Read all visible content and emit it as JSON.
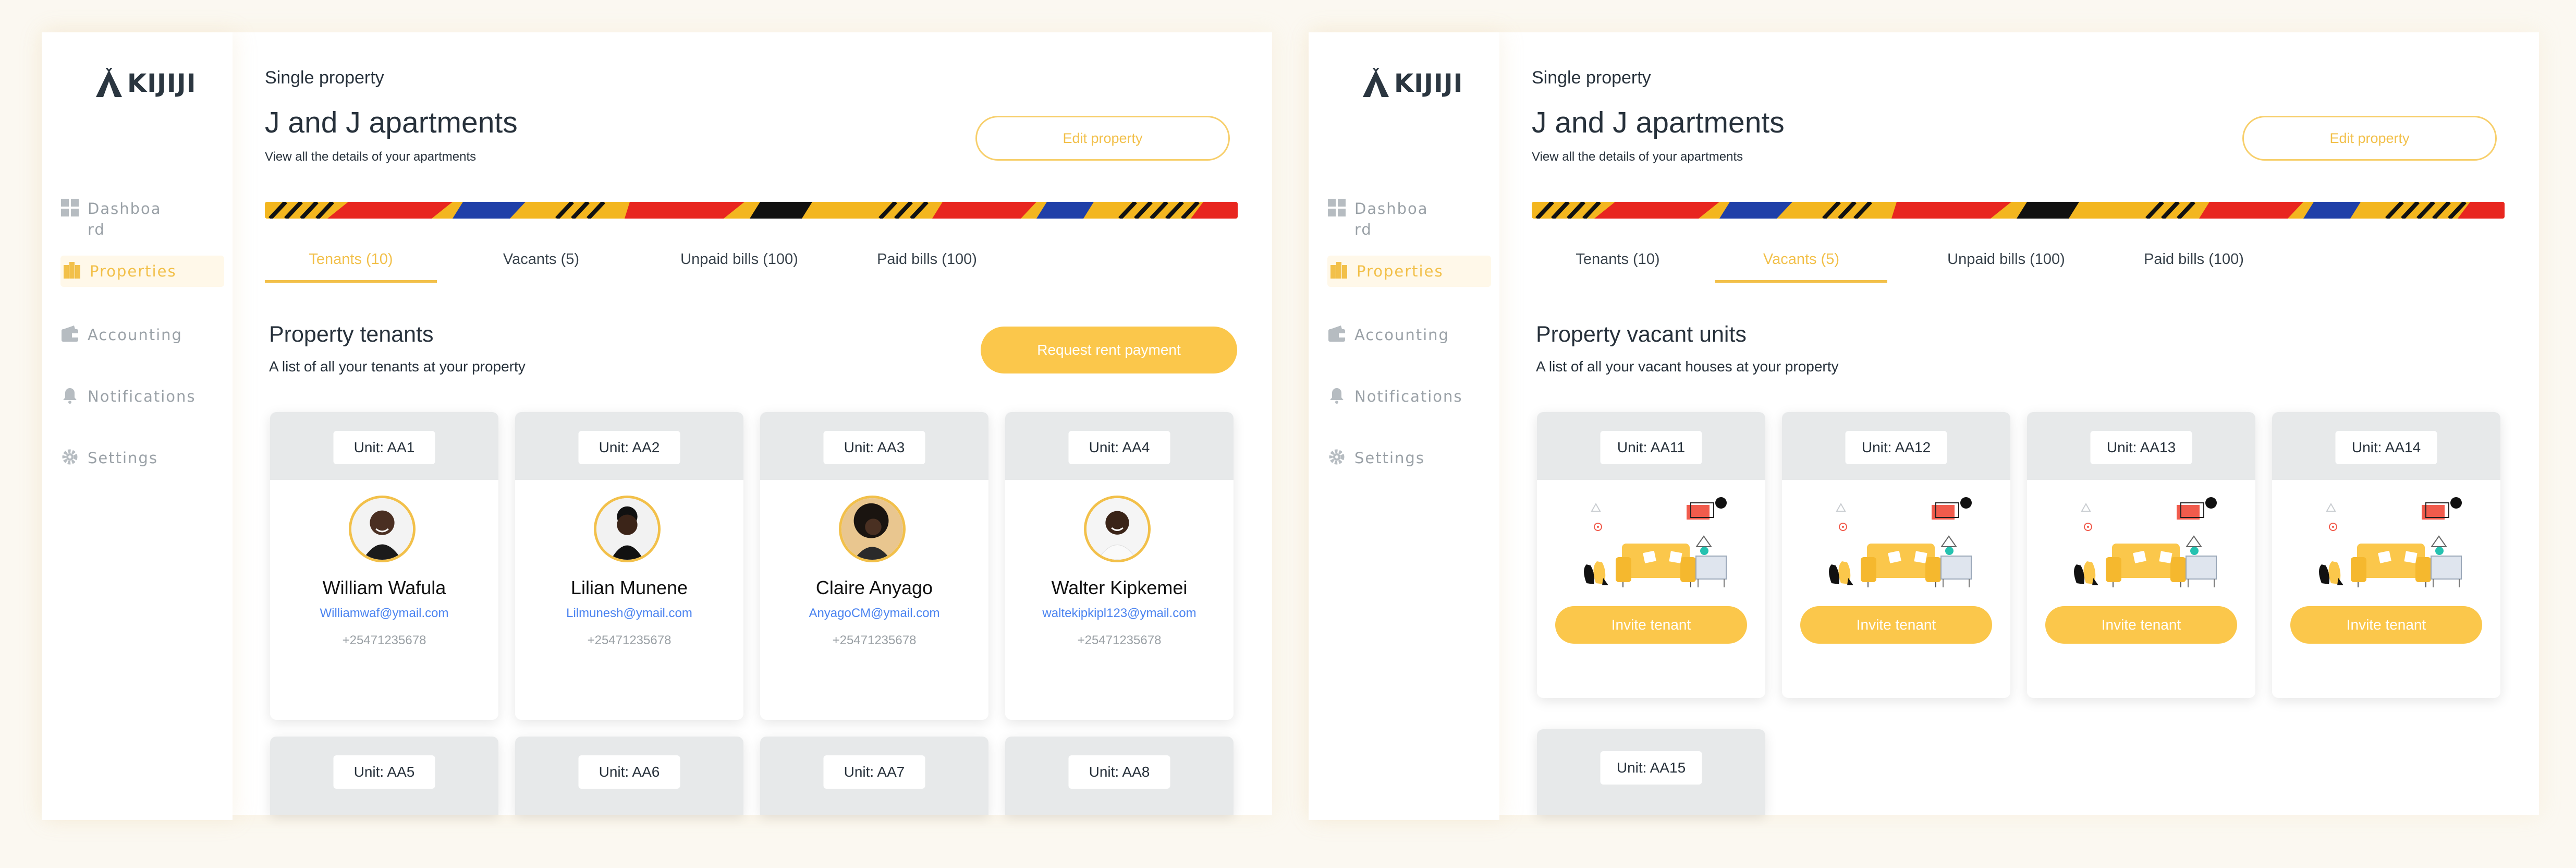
{
  "brand": {
    "logo_text": "KIJIJI"
  },
  "colors": {
    "accent": "#f2c04a",
    "button": "#fbc74b",
    "link": "#4a83f0"
  },
  "sidebar": {
    "items": [
      {
        "label": "Dashboard",
        "icon": "dashboard-icon"
      },
      {
        "label": "Properties",
        "icon": "building-icon"
      },
      {
        "label": "Accounting",
        "icon": "wallet-icon"
      },
      {
        "label": "Notifications",
        "icon": "bell-icon"
      },
      {
        "label": "Settings",
        "icon": "gear-icon"
      }
    ]
  },
  "page": {
    "breadcrumb": "Single property",
    "title": "J and J apartments",
    "subtitle": "View all the details of your apartments",
    "edit_label": "Edit property"
  },
  "tabs": [
    {
      "label": "Tenants (10)"
    },
    {
      "label": "Vacants (5)"
    },
    {
      "label": "Unpaid bills (100)"
    },
    {
      "label": "Paid bills (100)"
    }
  ],
  "tenants_section": {
    "title": "Property tenants",
    "subtitle": "A list of all your tenants at your property",
    "request_label": "Request rent payment",
    "tenants": [
      {
        "unit": "Unit: AA1",
        "name": "William Wafula",
        "email": "Williamwaf@ymail.com",
        "phone": "+25471235678"
      },
      {
        "unit": "Unit: AA2",
        "name": "Lilian Munene",
        "email": "Lilmunesh@ymail.com",
        "phone": "+25471235678"
      },
      {
        "unit": "Unit: AA3",
        "name": "Claire Anyago",
        "email": "AnyagoCM@ymail.com",
        "phone": "+25471235678"
      },
      {
        "unit": "Unit: AA4",
        "name": "Walter Kipkemei",
        "email": "waltekipkipl123@ymail.com",
        "phone": "+25471235678"
      }
    ],
    "more_units": [
      "Unit: AA5",
      "Unit: AA6",
      "Unit: AA7",
      "Unit: AA8"
    ]
  },
  "vacants_section": {
    "title": "Property vacant units",
    "subtitle": "A list of all your vacant houses at your property",
    "invite_label": "Invite tenant",
    "units": [
      "Unit: AA11",
      "Unit: AA12",
      "Unit: AA13",
      "Unit: AA14"
    ],
    "more_units": [
      "Unit: AA15"
    ]
  }
}
